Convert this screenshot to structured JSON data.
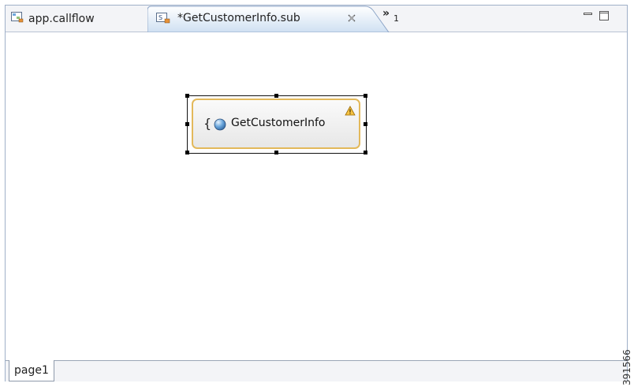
{
  "tabs": [
    {
      "label": "app.callflow",
      "icon": "callflow-file-icon",
      "active": false
    },
    {
      "label": "*GetCustomerInfo.sub",
      "icon": "subflow-file-icon",
      "active": true,
      "dirty": true
    }
  ],
  "overflow": {
    "chevron": "»",
    "count": "1"
  },
  "canvas": {
    "node": {
      "label": "GetCustomerInfo",
      "prefix": "{",
      "icon": "globe-icon",
      "status_icon": "warning-icon",
      "selected": true
    }
  },
  "page_tabs": [
    {
      "label": "page1",
      "active": true
    }
  ],
  "watermark": "391566",
  "colors": {
    "node_border": "#e3b95b",
    "tab_active_fill": "#d7e5f4",
    "warning": "#f0b400"
  }
}
